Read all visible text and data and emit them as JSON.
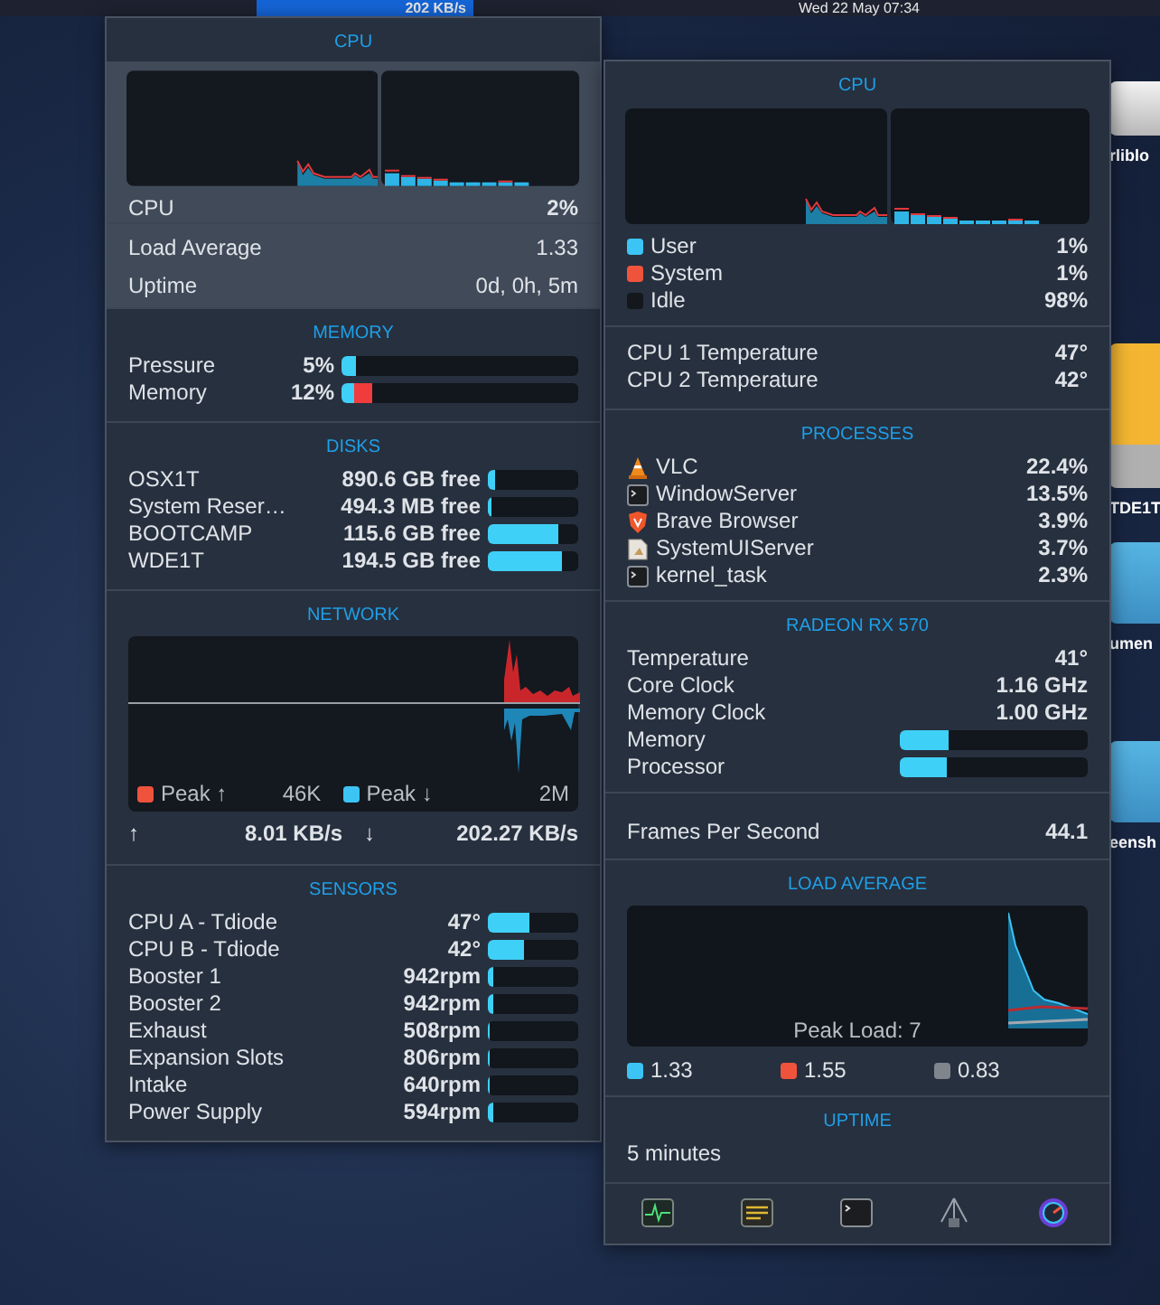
{
  "menu_bar": {
    "status_item": {
      "text": "202 KB/s",
      "selected": true
    },
    "clock": "Wed 22 May  07:34"
  },
  "desktop_items": [
    {
      "label": "rliblo",
      "kind": "drive"
    },
    {
      "label": "TDE1T",
      "kind": "orange-drive"
    },
    {
      "label": "umen",
      "kind": "folder"
    },
    {
      "label": "eensh",
      "kind": "folder"
    }
  ],
  "left_panel": {
    "cpu": {
      "title": "CPU",
      "label": "CPU",
      "value": "2%",
      "load_average": {
        "label": "Load Average",
        "value": "1.33"
      },
      "uptime": {
        "label": "Uptime",
        "value": "0d, 0h, 5m"
      }
    },
    "memory": {
      "title": "MEMORY",
      "rows": [
        {
          "label": "Pressure",
          "value": "5%",
          "segments": [
            {
              "color": "#3fd0f8",
              "level": 0.06
            }
          ]
        },
        {
          "label": "Memory",
          "value": "12%",
          "segments": [
            {
              "color": "#3fd0f8",
              "level": 0.05
            },
            {
              "color": "#f03c3c",
              "level": 0.08
            }
          ]
        }
      ]
    },
    "disks": {
      "title": "DISKS",
      "rows": [
        {
          "label": "OSX1T",
          "value": "890.6 GB free",
          "level": 0.08
        },
        {
          "label": "System Reser…",
          "value": "494.3 MB free",
          "level": 0.03
        },
        {
          "label": "BOOTCAMP",
          "value": "115.6 GB free",
          "level": 0.77
        },
        {
          "label": "WDE1T",
          "value": "194.5 GB free",
          "level": 0.81
        }
      ]
    },
    "network": {
      "title": "NETWORK",
      "legend": [
        {
          "label": "Peak ↑",
          "value": "46K",
          "color": "#f0533c"
        },
        {
          "label": "Peak ↓",
          "value": "2M",
          "color": "#3cc4f5"
        }
      ],
      "upload_arrow": "↑",
      "upload": "8.01 KB/s",
      "download_arrow": "↓",
      "download": "202.27 KB/s"
    },
    "sensors": {
      "title": "SENSORS",
      "rows": [
        {
          "label": "CPU A - Tdiode",
          "value": "47°",
          "level": 0.46
        },
        {
          "label": "CPU B - Tdiode",
          "value": "42°",
          "level": 0.39
        },
        {
          "label": "Booster 1",
          "value": "942rpm",
          "level": 0.05
        },
        {
          "label": "Booster 2",
          "value": "942rpm",
          "level": 0.05
        },
        {
          "label": "Exhaust",
          "value": "508rpm",
          "level": 0.02
        },
        {
          "label": "Expansion Slots",
          "value": "806rpm",
          "level": 0.02
        },
        {
          "label": "Intake",
          "value": "640rpm",
          "level": 0.02
        },
        {
          "label": "Power Supply",
          "value": "594rpm",
          "level": 0.06
        }
      ]
    }
  },
  "right_panel": {
    "cpu": {
      "title": "CPU",
      "legend": [
        {
          "label": "User",
          "value": "1%",
          "color": "#3cc4f5"
        },
        {
          "label": "System",
          "value": "1%",
          "color": "#f0533c"
        },
        {
          "label": "Idle",
          "value": "98%",
          "color": "#14171c"
        }
      ],
      "temperatures": [
        {
          "label": "CPU 1 Temperature",
          "value": "47°"
        },
        {
          "label": "CPU 2 Temperature",
          "value": "42°"
        }
      ]
    },
    "processes": {
      "title": "PROCESSES",
      "rows": [
        {
          "kind": "cone",
          "name": "VLC",
          "value": "22.4%"
        },
        {
          "kind": "terminal",
          "name": "WindowServer",
          "value": "13.5%"
        },
        {
          "kind": "shield",
          "name": "Brave Browser",
          "value": "3.9%"
        },
        {
          "kind": "document",
          "name": "SystemUIServer",
          "value": "3.7%"
        },
        {
          "kind": "terminal",
          "name": "kernel_task",
          "value": "2.3%"
        }
      ]
    },
    "gpu": {
      "title": "RADEON RX 570",
      "rows": [
        {
          "kind": "text",
          "label": "Temperature",
          "value": "41°"
        },
        {
          "kind": "text",
          "label": "Core Clock",
          "value": "1.16 GHz"
        },
        {
          "kind": "text",
          "label": "Memory Clock",
          "value": "1.00 GHz"
        },
        {
          "kind": "bar",
          "label": "Memory",
          "level": 0.26
        },
        {
          "kind": "bar",
          "label": "Processor",
          "level": 0.25
        }
      ]
    },
    "fps": {
      "label": "Frames Per Second",
      "value": "44.1"
    },
    "load_average": {
      "title": "LOAD AVERAGE",
      "peak": "Peak Load: 7",
      "legend": [
        {
          "value": "1.33",
          "color": "#3cc4f5"
        },
        {
          "value": "1.55",
          "color": "#f0533c"
        },
        {
          "value": "0.83",
          "color": "#80858d"
        }
      ]
    },
    "uptime": {
      "title": "UPTIME",
      "value": "5 minutes"
    },
    "toolbar": [
      {
        "kind": "activity"
      },
      {
        "kind": "console"
      },
      {
        "kind": "terminal"
      },
      {
        "kind": "network"
      },
      {
        "kind": "gauge"
      }
    ]
  }
}
